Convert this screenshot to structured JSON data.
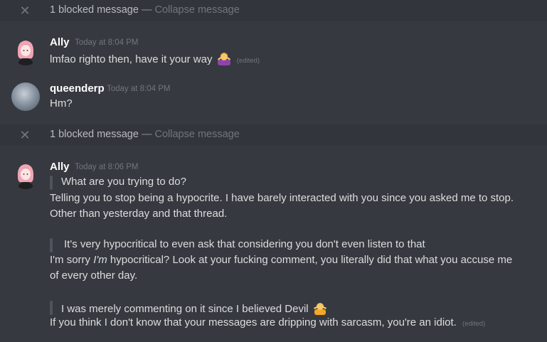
{
  "blocked_1": {
    "close_icon": "close-icon",
    "count_text": "1 blocked message",
    "separator": "—",
    "collapse_label": "Collapse message"
  },
  "msg1": {
    "username": "Ally",
    "timestamp": "Today at 8:04 PM",
    "text": "lmfao righto then, have it your way",
    "emoji": "woman-shrugging-emoji",
    "edited": "(edited)"
  },
  "msg2": {
    "username": "queenderp",
    "timestamp": "Today at 8:04 PM",
    "text": "Hm?"
  },
  "blocked_2": {
    "count_text": "1 blocked message",
    "separator": "—",
    "collapse_label": "Collapse message"
  },
  "msg3": {
    "username": "Ally",
    "timestamp": "Today at 8:06 PM",
    "quote1": "What are you trying to do?",
    "line1": "Telling you to stop being a hypocrite. I have barely interacted with you since you asked me to stop.",
    "line2": "Other than yesterday and that thread.",
    "quote2": "It's very hypocritical to even ask that considering you don't even listen to that",
    "line3_pre": "I'm sorry ",
    "line3_em": "I'm",
    "line3_post": " hypocritical? Look at your fucking comment, you literally did that what you accuse me",
    "line4": "of every other day.",
    "quote3": "I was merely commenting on it since I believed Devil",
    "quote3_emoji": "person-shrugging-emoji",
    "line5": "If you think I don't know that your messages are dripping with sarcasm, you're an idiot.",
    "edited": "(edited)"
  },
  "colors": {
    "background": "#36393f",
    "blocked_bg": "#32353b",
    "username": "#ffffff",
    "text": "#dcddde",
    "muted": "#72767d",
    "quote_bar": "#4f545c"
  }
}
